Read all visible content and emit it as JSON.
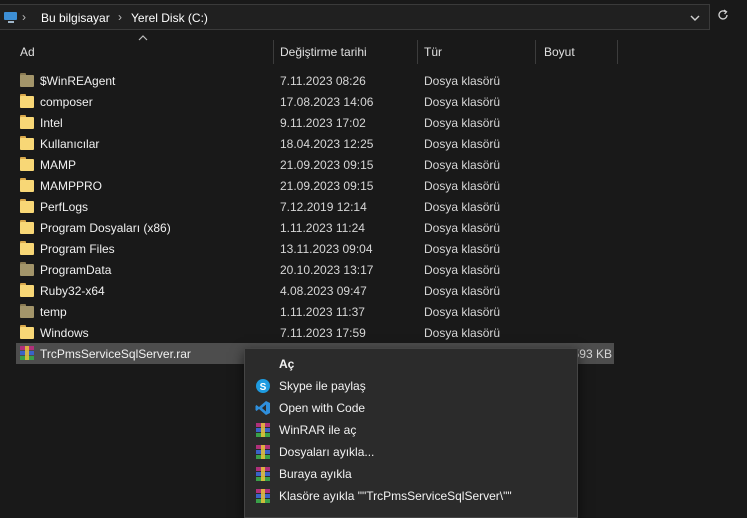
{
  "breadcrumb": {
    "items": [
      "Bu bilgisayar",
      "Yerel Disk (C:)"
    ]
  },
  "columns": {
    "name": "Ad",
    "date": "Değiştirme tarihi",
    "type": "Tür",
    "size": "Boyut"
  },
  "files": [
    {
      "name": "$WinREAgent",
      "date": "7.11.2023 08:26",
      "type": "Dosya klasörü",
      "size": "",
      "icon": "folder-system-icon"
    },
    {
      "name": "composer",
      "date": "17.08.2023 14:06",
      "type": "Dosya klasörü",
      "size": "",
      "icon": "folder-icon"
    },
    {
      "name": "Intel",
      "date": "9.11.2023 17:02",
      "type": "Dosya klasörü",
      "size": "",
      "icon": "folder-icon"
    },
    {
      "name": "Kullanıcılar",
      "date": "18.04.2023 12:25",
      "type": "Dosya klasörü",
      "size": "",
      "icon": "folder-icon"
    },
    {
      "name": "MAMP",
      "date": "21.09.2023 09:15",
      "type": "Dosya klasörü",
      "size": "",
      "icon": "folder-icon"
    },
    {
      "name": "MAMPPRO",
      "date": "21.09.2023 09:15",
      "type": "Dosya klasörü",
      "size": "",
      "icon": "folder-icon"
    },
    {
      "name": "PerfLogs",
      "date": "7.12.2019 12:14",
      "type": "Dosya klasörü",
      "size": "",
      "icon": "folder-icon"
    },
    {
      "name": "Program Dosyaları (x86)",
      "date": "1.11.2023 11:24",
      "type": "Dosya klasörü",
      "size": "",
      "icon": "folder-icon"
    },
    {
      "name": "Program Files",
      "date": "13.11.2023 09:04",
      "type": "Dosya klasörü",
      "size": "",
      "icon": "folder-icon"
    },
    {
      "name": "ProgramData",
      "date": "20.10.2023 13:17",
      "type": "Dosya klasörü",
      "size": "",
      "icon": "folder-system-icon"
    },
    {
      "name": "Ruby32-x64",
      "date": "4.08.2023 09:47",
      "type": "Dosya klasörü",
      "size": "",
      "icon": "folder-icon"
    },
    {
      "name": "temp",
      "date": "1.11.2023 11:37",
      "type": "Dosya klasörü",
      "size": "",
      "icon": "folder-system-icon"
    },
    {
      "name": "Windows",
      "date": "7.11.2023 17:59",
      "type": "Dosya klasörü",
      "size": "",
      "icon": "folder-icon"
    },
    {
      "name": "TrcPmsServiceSqlServer.rar",
      "date": "",
      "type": "",
      "size": "593 KB",
      "icon": "winrar-archive-icon"
    }
  ],
  "context_menu": {
    "items": [
      {
        "label": "Aç",
        "icon": "",
        "bold": true
      },
      {
        "label": "Skype ile paylaş",
        "icon": "skype-icon"
      },
      {
        "label": "Open with Code",
        "icon": "vscode-icon"
      },
      {
        "label": "WinRAR ile aç",
        "icon": "winrar-icon"
      },
      {
        "label": "Dosyaları ayıkla...",
        "icon": "winrar-icon"
      },
      {
        "label": "Buraya ayıkla",
        "icon": "winrar-icon"
      },
      {
        "label": "Klasöre ayıkla \"\"TrcPmsServiceSqlServer\\\"\"",
        "icon": "winrar-icon"
      }
    ]
  },
  "colors": {
    "background": "#191919",
    "selected_row": "#4d4d4d",
    "menu_background": "#2b2b2b",
    "folder": "#f8d776"
  }
}
